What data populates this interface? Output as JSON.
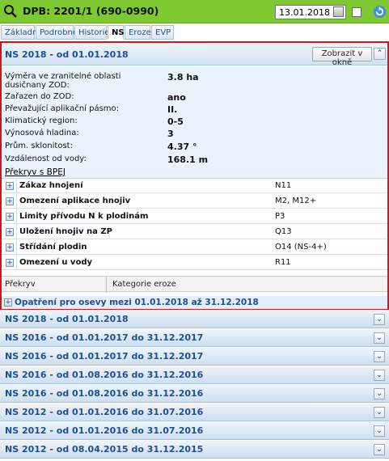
{
  "header": {
    "title": "DPB: 2201/1 (690-0990)",
    "date": "13.01.2018",
    "accent": "#7ec832"
  },
  "tabs": [
    "Základní",
    "Podrobné",
    "Historie",
    "NS",
    "Eroze",
    "EVP"
  ],
  "active_tab": "NS",
  "panel": {
    "title": "NS 2018 - od 01.01.2018",
    "open_window_label": "Zobrazit v okně",
    "info": [
      {
        "label": "Výměra ve zranitelné oblasti dusičnany ZOD:",
        "value": "3.8 ha"
      },
      {
        "label": "Zařazen do ZOD:",
        "value": "ano"
      },
      {
        "label": "Převažující aplikační pásmo:",
        "value": "II."
      },
      {
        "label": "Klimatický region:",
        "value": "0-5"
      },
      {
        "label": "Výnosová hladina:",
        "value": "3"
      },
      {
        "label": "Prům. sklonitost:",
        "value": "4.37 °"
      },
      {
        "label": "Vzdálenost od vody:",
        "value": "168.1 m"
      }
    ],
    "link": "Překryv s BPEJ",
    "grid": [
      {
        "name": "Zákaz hnojení",
        "value": "N11"
      },
      {
        "name": "Omezení aplikace hnojiv",
        "value": "M2, M12+"
      },
      {
        "name": "Limity přívodu N k plodinám",
        "value": "P3"
      },
      {
        "name": "Uložení hnojiv na ZP",
        "value": "Q13"
      },
      {
        "name": "Střídání plodin",
        "value": "O14 (NS-4+)"
      },
      {
        "name": "Omezení u vody",
        "value": "R11"
      }
    ],
    "sub_columns": [
      "Překryv",
      "Kategorie eroze"
    ],
    "opatreni": "Opatření pro osevy mezi 01.01.2018 až 31.12.2018"
  },
  "collapsed": [
    "NS 2018 - od 01.01.2018",
    "NS 2016 - od 01.01.2017 do 31.12.2017",
    "NS 2016 - od 01.01.2017 do 31.12.2017",
    "NS 2016 - od 01.08.2016 do 31.12.2016",
    "NS 2016 - od 01.08.2016 do 31.12.2016",
    "NS 2012 - od 01.01.2016 do 31.07.2016",
    "NS 2012 - od 01.01.2016 do 31.07.2016",
    "NS 2012 - od 08.04.2015 do 31.12.2015"
  ]
}
